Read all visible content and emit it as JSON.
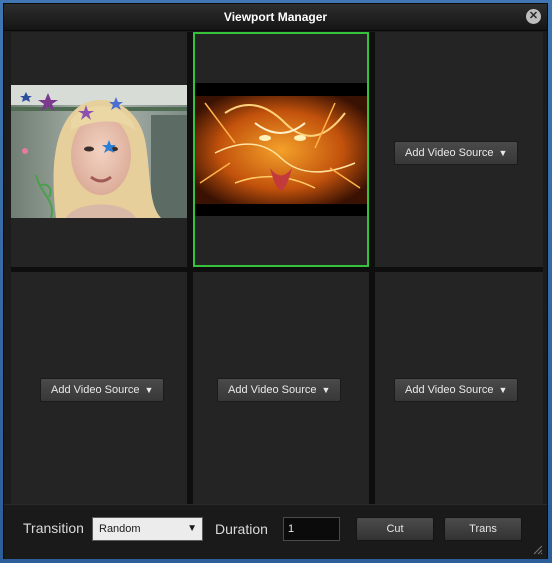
{
  "window": {
    "title": "Viewport Manager",
    "close_glyph": "✕"
  },
  "cells": [
    {
      "id": 1,
      "content": "webcam video: smiling woman with star decorations"
    },
    {
      "id": 2,
      "content": "video: fiery orange lion artwork",
      "selected": true
    },
    {
      "id": 3,
      "add_label": "Add Video Source"
    },
    {
      "id": 4,
      "add_label": "Add Video Source"
    },
    {
      "id": 5,
      "add_label": "Add Video Source"
    },
    {
      "id": 6,
      "add_label": "Add Video Source"
    }
  ],
  "footer": {
    "transition_label": "Transition",
    "transition_value": "Random",
    "duration_label": "Duration",
    "duration_value": "1",
    "cut_label": "Cut",
    "trans_label": "Trans"
  },
  "colors": {
    "selected_border": "#37c23c",
    "window_bg": "#1c1c1c"
  }
}
